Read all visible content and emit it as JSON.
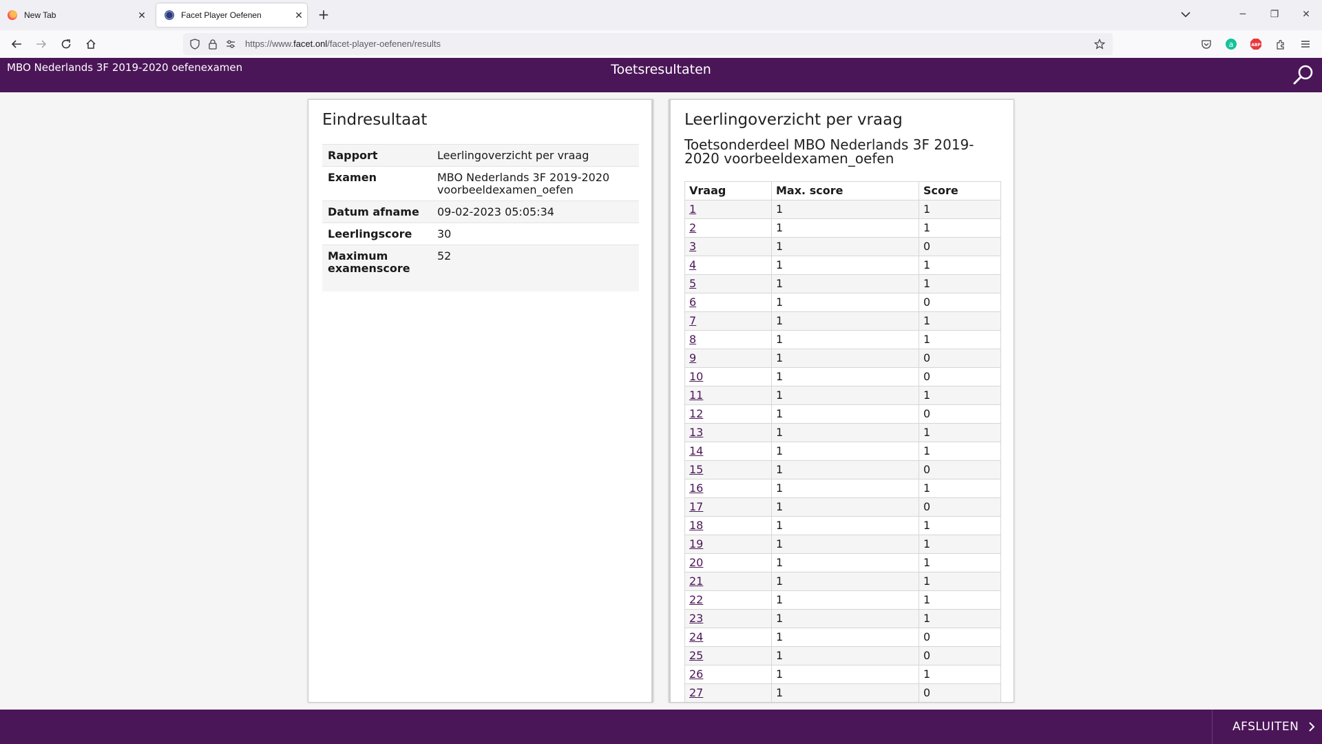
{
  "browser": {
    "tabs": [
      {
        "title": "New Tab",
        "active": false
      },
      {
        "title": "Facet Player Oefenen",
        "active": true
      }
    ],
    "url_prefix": "https://www.",
    "url_domain": "facet.onl",
    "url_path": "/facet-player-oefenen/results"
  },
  "header": {
    "exam_title": "MBO Nederlands 3F 2019-2020 oefenexamen",
    "page_title": "Toetsresultaten"
  },
  "left_panel": {
    "heading": "Eindresultaat",
    "rows": [
      {
        "key": "Rapport",
        "value": "Leerlingoverzicht per vraag"
      },
      {
        "key": "Examen",
        "value": "MBO Nederlands 3F 2019-2020 voorbeeldexamen_oefen"
      },
      {
        "key": "Datum afname",
        "value": "09-02-2023 05:05:34"
      },
      {
        "key": "Leerlingscore",
        "value": "30"
      },
      {
        "key": "Maximum examenscore",
        "value": "52"
      }
    ]
  },
  "right_panel": {
    "heading": "Leerlingoverzicht per vraag",
    "subtitle": "Toetsonderdeel MBO Nederlands 3F 2019-2020 voorbeeldexamen_oefen",
    "columns": [
      "Vraag",
      "Max. score",
      "Score"
    ],
    "rows": [
      [
        "1",
        "1",
        "1"
      ],
      [
        "2",
        "1",
        "1"
      ],
      [
        "3",
        "1",
        "0"
      ],
      [
        "4",
        "1",
        "1"
      ],
      [
        "5",
        "1",
        "1"
      ],
      [
        "6",
        "1",
        "0"
      ],
      [
        "7",
        "1",
        "1"
      ],
      [
        "8",
        "1",
        "1"
      ],
      [
        "9",
        "1",
        "0"
      ],
      [
        "10",
        "1",
        "0"
      ],
      [
        "11",
        "1",
        "1"
      ],
      [
        "12",
        "1",
        "0"
      ],
      [
        "13",
        "1",
        "1"
      ],
      [
        "14",
        "1",
        "1"
      ],
      [
        "15",
        "1",
        "0"
      ],
      [
        "16",
        "1",
        "1"
      ],
      [
        "17",
        "1",
        "0"
      ],
      [
        "18",
        "1",
        "1"
      ],
      [
        "19",
        "1",
        "1"
      ],
      [
        "20",
        "1",
        "1"
      ],
      [
        "21",
        "1",
        "1"
      ],
      [
        "22",
        "1",
        "1"
      ],
      [
        "23",
        "1",
        "1"
      ],
      [
        "24",
        "1",
        "0"
      ],
      [
        "25",
        "1",
        "0"
      ],
      [
        "26",
        "1",
        "1"
      ],
      [
        "27",
        "1",
        "0"
      ]
    ]
  },
  "footer": {
    "close_label": "AFSLUITEN"
  },
  "colors": {
    "brand_purple": "#4b1658"
  }
}
